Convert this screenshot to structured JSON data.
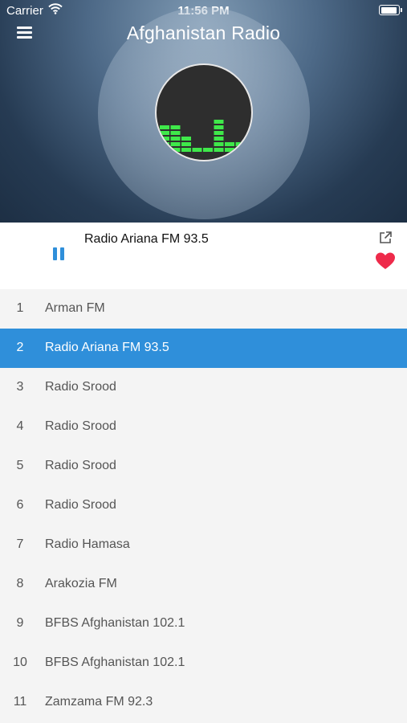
{
  "status": {
    "carrier": "Carrier",
    "time": "11:56 PM"
  },
  "header": {
    "title": "Afghanistan Radio"
  },
  "now_playing": {
    "station": "Radio Ariana FM 93.5"
  },
  "colors": {
    "accent": "#2f8fda",
    "heart": "#ee2a4a",
    "equalizer": "#3fe84a"
  },
  "stations": [
    {
      "num": "1",
      "name": "Arman FM",
      "active": false
    },
    {
      "num": "2",
      "name": "Radio Ariana FM 93.5",
      "active": true
    },
    {
      "num": "3",
      "name": "Radio Srood",
      "active": false
    },
    {
      "num": "4",
      "name": "Radio Srood",
      "active": false
    },
    {
      "num": "5",
      "name": "Radio Srood",
      "active": false
    },
    {
      "num": "6",
      "name": "Radio Srood",
      "active": false
    },
    {
      "num": "7",
      "name": "Radio Hamasa",
      "active": false
    },
    {
      "num": "8",
      "name": "Arakozia FM",
      "active": false
    },
    {
      "num": "9",
      "name": "BFBS Afghanistan 102.1",
      "active": false
    },
    {
      "num": "10",
      "name": "BFBS Afghanistan 102.1",
      "active": false
    },
    {
      "num": "11",
      "name": "Zamzama FM 92.3",
      "active": false
    }
  ]
}
